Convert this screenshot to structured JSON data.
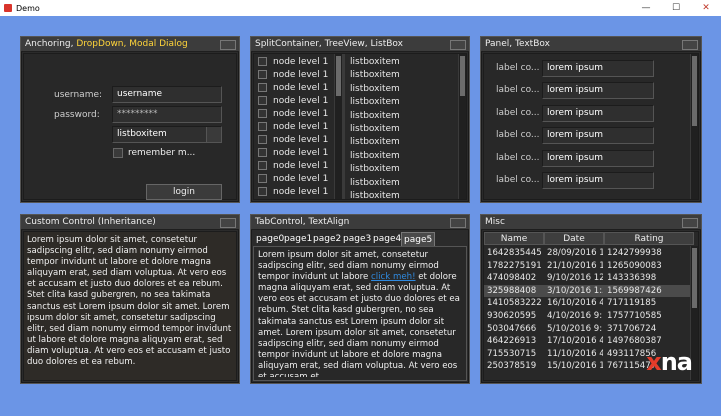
{
  "window": {
    "title": "Demo",
    "btn_min": "—",
    "btn_max": "☐",
    "btn_close": "✕"
  },
  "panel1": {
    "title_part1": "Anchoring, ",
    "title_part2": "DropDown, Modal Dialog",
    "username_label": "username:",
    "username_value": "username",
    "password_label": "password:",
    "password_value": "*********",
    "dropdown_value": "listboxitem",
    "remember_label": "remember m...",
    "login_label": "login"
  },
  "panel2": {
    "title": "SplitContainer, TreeView, ListBox",
    "tree_items": [
      "node level 1",
      "node level 1",
      "node level 1",
      "node level 1",
      "node level 1",
      "node level 1",
      "node level 1",
      "node level 1",
      "node level 1",
      "node level 1",
      "node level 1"
    ],
    "list_items": [
      "listboxitem",
      "listboxitem",
      "listboxitem",
      "listboxitem",
      "listboxitem",
      "listboxitem",
      "listboxitem",
      "listboxitem",
      "listboxitem",
      "listboxitem",
      "listboxitem"
    ]
  },
  "panel3": {
    "title": "Panel, TextBox",
    "rows": [
      {
        "label": "label co...",
        "value": "lorem ipsum"
      },
      {
        "label": "label co...",
        "value": "lorem ipsum"
      },
      {
        "label": "label co...",
        "value": "lorem ipsum"
      },
      {
        "label": "label co...",
        "value": "lorem ipsum"
      },
      {
        "label": "label co...",
        "value": "lorem ipsum"
      },
      {
        "label": "label co...",
        "value": "lorem ipsum"
      }
    ]
  },
  "panel4": {
    "title": "Custom Control (Inheritance)",
    "text": "Lorem ipsum dolor sit amet, consetetur sadipscing elitr, sed diam nonumy eirmod tempor invidunt ut labore et dolore magna aliquyam erat, sed diam voluptua. At vero eos et accusam et justo duo dolores et ea rebum. Stet clita kasd gubergren, no sea takimata sanctus est Lorem ipsum dolor sit amet. Lorem ipsum dolor sit amet, consetetur sadipscing elitr, sed diam nonumy eirmod tempor invidunt ut labore et dolore magna aliquyam erat, sed diam voluptua. At vero eos et accusam et justo duo dolores et ea rebum."
  },
  "panel5": {
    "title": "TabControl, TextAlign",
    "tabs": [
      "page0",
      "page1",
      "page2",
      "page3",
      "page4",
      "page5"
    ],
    "text_before": "Lorem ipsum dolor sit amet, consetetur sadipscing elitr, sed diam nonumy eirmod tempor invidunt ut labore ",
    "link": "click meh!",
    "text_after": " et dolore magna aliquyam erat, sed diam voluptua. At vero eos et accusam et justo duo dolores et ea rebum. Stet clita kasd gubergren, no sea takimata sanctus est Lorem ipsum dolor sit amet. Lorem ipsum dolor sit amet, consetetur sadipscing elitr, sed diam nonumy eirmod tempor invidunt ut labore et dolore magna aliquyam erat, sed diam voluptua. At vero eos et accusam et"
  },
  "panel6": {
    "title": "Misc",
    "columns": [
      "Name",
      "Date",
      "Rating"
    ],
    "rows": [
      [
        "1642835445",
        "28/09/2016 1",
        "1242799938"
      ],
      [
        "1782275191",
        "21/10/2016 1",
        "1265090083"
      ],
      [
        "474098402",
        "9/10/2016 12",
        "143336398"
      ],
      [
        "325988408",
        "3/10/2016 1:3",
        "1569987426"
      ],
      [
        "1410583222",
        "16/10/2016 4",
        "717119185"
      ],
      [
        "930620595",
        "4/10/2016 9:",
        "1757710585"
      ],
      [
        "503047666",
        "5/10/2016 9:1",
        "371706724"
      ],
      [
        "464226913",
        "17/10/2016 4",
        "1497680387"
      ],
      [
        "715530715",
        "11/10/2016 4",
        "493117856"
      ],
      [
        "250378519",
        "15/10/2016 1",
        "767115477"
      ]
    ],
    "logo_x": "x",
    "logo_rest": "na"
  }
}
